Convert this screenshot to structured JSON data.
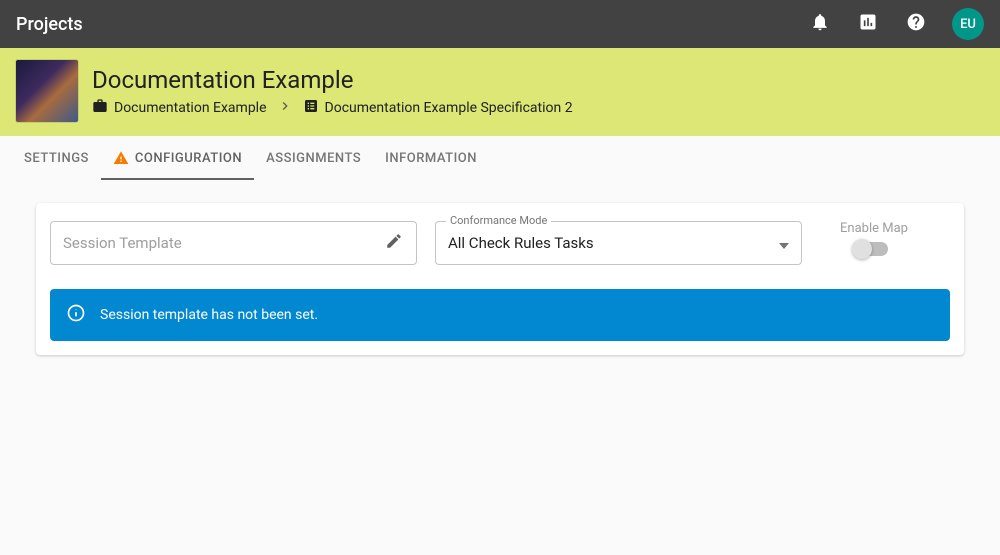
{
  "topbar": {
    "title": "Projects",
    "avatar_initials": "EU"
  },
  "header": {
    "title": "Documentation Example",
    "breadcrumb": {
      "project": "Documentation Example",
      "spec": "Documentation Example Specification 2"
    }
  },
  "tabs": {
    "settings": "SETTINGS",
    "configuration": "CONFIGURATION",
    "assignments": "ASSIGNMENTS",
    "information": "INFORMATION"
  },
  "form": {
    "session_template_placeholder": "Session Template",
    "conformance_label": "Conformance Mode",
    "conformance_value": "All Check Rules Tasks",
    "enable_map_label": "Enable Map"
  },
  "alert": {
    "message": "Session template has not been set."
  }
}
